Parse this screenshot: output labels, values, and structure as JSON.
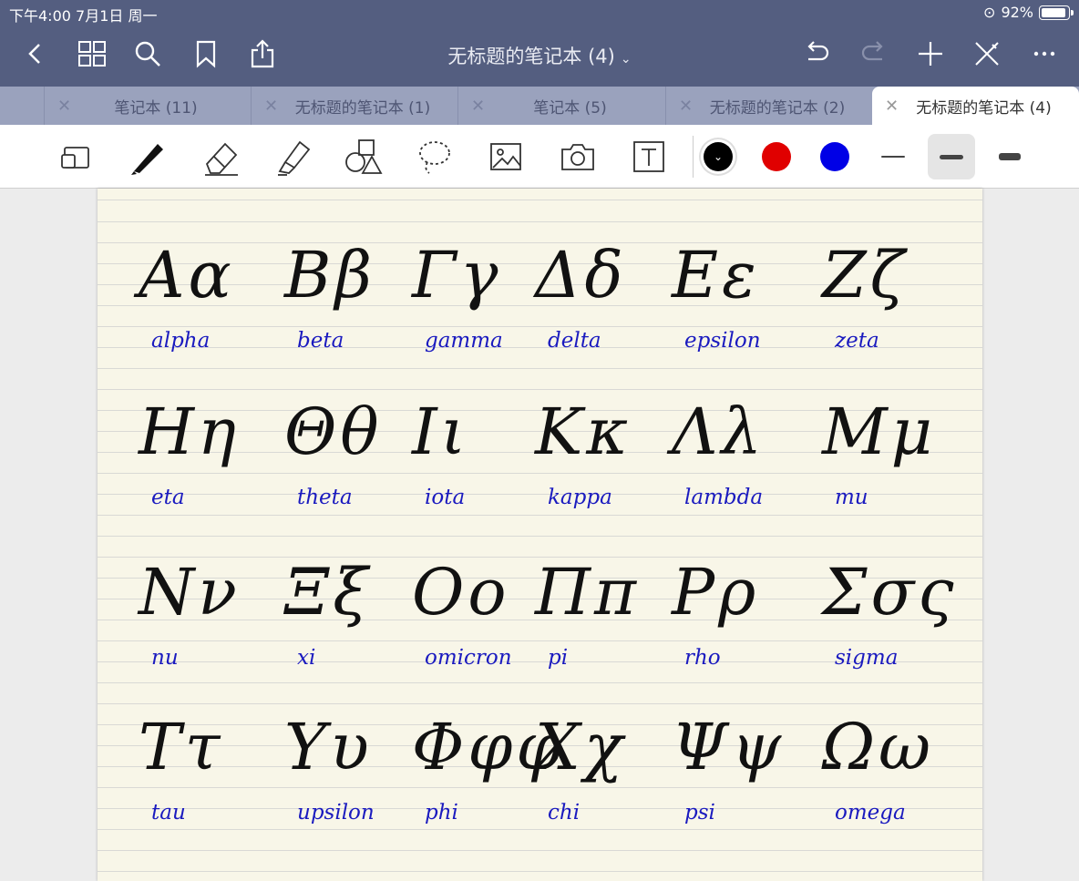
{
  "status": {
    "time_date": "下午4:00   7月1日 周一",
    "battery": "92%"
  },
  "nav": {
    "title": "无标题的笔记本 (4)",
    "icons": [
      "back-icon",
      "grid-icon",
      "search-icon",
      "bookmark-icon",
      "share-icon",
      "undo-icon",
      "redo-icon",
      "add-icon",
      "close-pen-icon",
      "more-icon"
    ]
  },
  "tabs": [
    {
      "label": "笔记本 (11)"
    },
    {
      "label": "无标题的笔记本 (1)"
    },
    {
      "label": "笔记本 (5)"
    },
    {
      "label": "无标题的笔记本 (2)"
    },
    {
      "label": "无标题的笔记本 (4)",
      "active": true
    }
  ],
  "toolbar": {
    "tools": [
      "read-mode-icon",
      "pen-icon",
      "eraser-icon",
      "highlighter-icon",
      "shapes-icon",
      "lasso-icon",
      "image-icon",
      "camera-icon",
      "text-icon"
    ],
    "colors": [
      "#000000",
      "#e00000",
      "#0000e6"
    ],
    "selected_color": "#000000",
    "strokes": [
      "thin",
      "medium",
      "thick"
    ],
    "selected_stroke": "medium"
  },
  "notes": {
    "rows": [
      [
        {
          "g": "Αα",
          "w": "alpha"
        },
        {
          "g": "Ββ",
          "w": "beta"
        },
        {
          "g": "Γγ",
          "w": "gamma"
        },
        {
          "g": "Δδ",
          "w": "delta"
        },
        {
          "g": "Εε",
          "w": "epsilon"
        },
        {
          "g": "Ζζ",
          "w": "zeta"
        }
      ],
      [
        {
          "g": "Ηη",
          "w": "eta"
        },
        {
          "g": "Θθ",
          "w": "theta"
        },
        {
          "g": "Ιι",
          "w": "iota"
        },
        {
          "g": "Κκ",
          "w": "kappa"
        },
        {
          "g": "Λλ",
          "w": "lambda"
        },
        {
          "g": "Μμ",
          "w": "mu"
        }
      ],
      [
        {
          "g": "Νν",
          "w": "nu"
        },
        {
          "g": "Ξξ",
          "w": "xi"
        },
        {
          "g": "Οο",
          "w": "omicron"
        },
        {
          "g": "Ππ",
          "w": "pi"
        },
        {
          "g": "Ρρ",
          "w": "rho"
        },
        {
          "g": "Σσς",
          "w": "sigma"
        }
      ],
      [
        {
          "g": "Ττ",
          "w": "tau"
        },
        {
          "g": "Υυ",
          "w": "upsilon"
        },
        {
          "g": "Φφφ",
          "w": "phi"
        },
        {
          "g": "Χχ",
          "w": "chi"
        },
        {
          "g": "Ψψ",
          "w": "psi"
        },
        {
          "g": "Ωω",
          "w": "omega"
        }
      ]
    ]
  }
}
